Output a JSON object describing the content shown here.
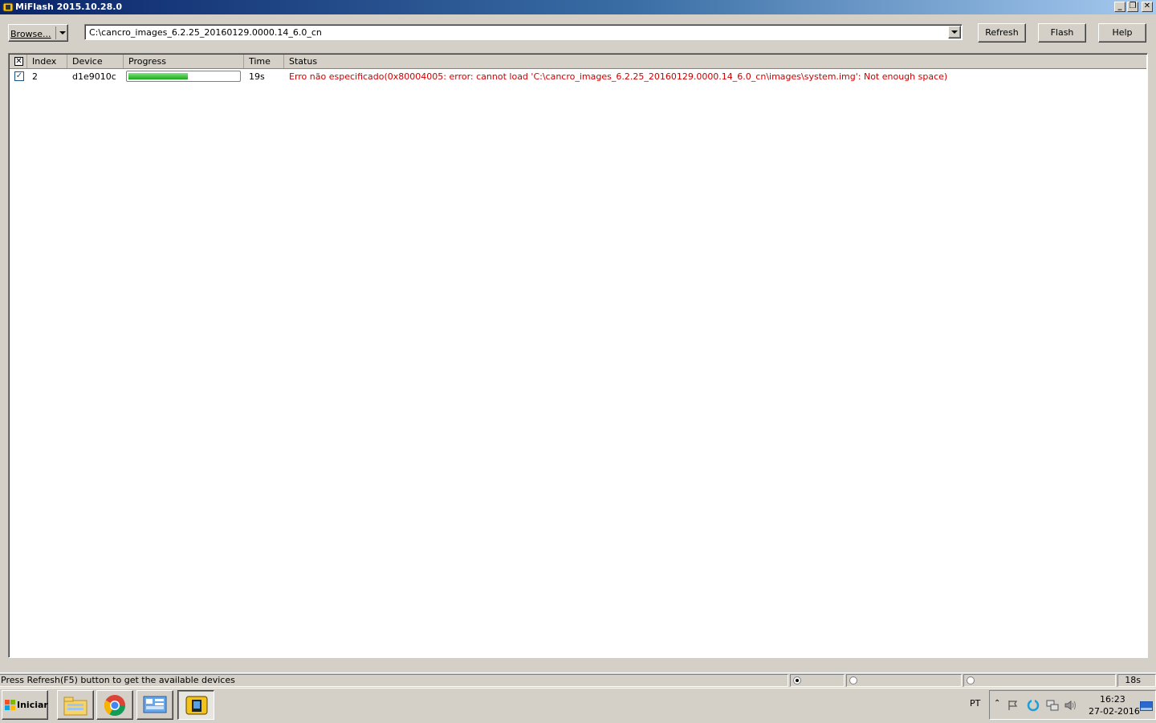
{
  "window": {
    "title": "MiFlash 2015.10.28.0",
    "controls": {
      "minimize": "_",
      "restore": "❐",
      "close": "✕"
    }
  },
  "toolbar": {
    "browse_label": "Browse...",
    "path_value": "C:\\cancro_images_6.2.25_20160129.0000.14_6.0_cn",
    "refresh_label": "Refresh",
    "flash_label": "Flash",
    "help_label": "Help"
  },
  "list": {
    "columns": {
      "index": "Index",
      "device": "Device",
      "progress": "Progress",
      "time": "Time",
      "status": "Status"
    },
    "rows": [
      {
        "checked": true,
        "index": "2",
        "device": "d1e9010c",
        "progress_fraction": 0.54,
        "time": "19s",
        "status": "Erro não especificado(0x80004005: error: cannot load 'C:\\cancro_images_6.2.25_20160129.0000.14_6.0_cn\\images\\system.img': Not enough space)"
      }
    ]
  },
  "statusbar": {
    "message": "Press Refresh(F5) button to get the available devices",
    "elapsed": "18s"
  },
  "taskbar": {
    "start_label": "Iniciar",
    "language": "PT",
    "time": "16:23",
    "date": "27-02-2016"
  },
  "colors": {
    "error_text": "#cc0000",
    "progress_green": "#22b022",
    "titlebar_start": "#0a246a",
    "titlebar_end": "#a6caf0"
  },
  "icons": [
    "miflash-app-icon",
    "windows-flag-icon",
    "file-explorer-icon",
    "chrome-icon",
    "control-panel-icon",
    "miflash-taskbar-icon",
    "tray-chevron-icon",
    "flag-icon",
    "update-icon",
    "network-icon",
    "volume-icon",
    "show-desktop-icon"
  ]
}
